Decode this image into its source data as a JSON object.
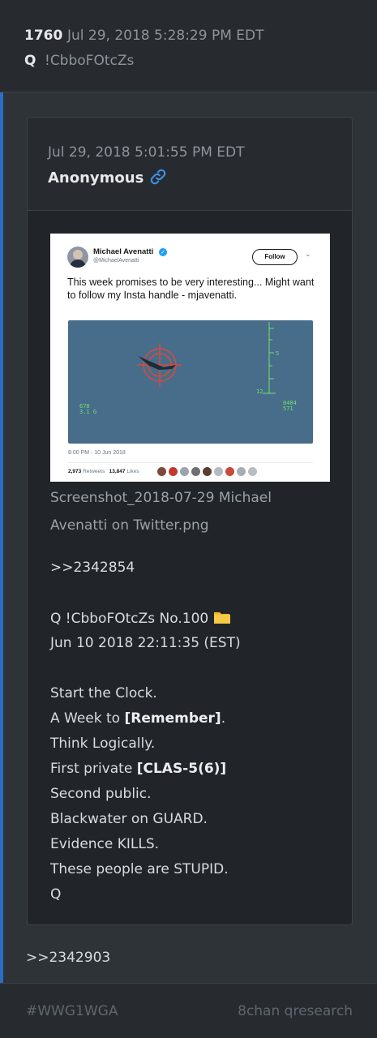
{
  "header": {
    "post_number": "1760",
    "date": "Jul 29, 2018 5:28:29 PM EDT",
    "author": "Q",
    "tripcode": "!CbboFOtcZs"
  },
  "quote": {
    "date": "Jul 29, 2018 5:01:55 PM EDT",
    "author": "Anonymous",
    "link_icon": "link-icon",
    "attachment": {
      "filename_line1": "Screenshot_2018-07-29 Michael",
      "filename_line2": "Avenatti on Twitter.png",
      "tweet": {
        "name": "Michael Avenatti",
        "handle": "@MichaelAvenatti",
        "verified_icon": "✓",
        "follow_label": "Follow",
        "chevron": "⌄",
        "text": "This week promises to be very interesting... Might want to follow my Insta handle - mjavenatti.",
        "hud_left_1": "678",
        "hud_left_2": "3.1 G",
        "hud_right_1": "0404",
        "hud_right_2": "571",
        "hud_num_1": "12",
        "hud_num_2": "5",
        "time": "8:00 PM - 10 Jun 2018",
        "retweets": "2,973",
        "retweets_label": "Retweets",
        "likes": "13,847",
        "likes_label": "Likes"
      }
    },
    "lines": [
      ">>2342854",
      "Q !CbboFOtcZs No.100",
      "Jun 10 2018 22:11:35 (EST)",
      "Start the Clock.",
      "A Week to ",
      "[Remember]",
      ".",
      "Think Logically.",
      "First private ",
      "[CLAS-5(6)]",
      "Second public.",
      "Blackwater on GUARD.",
      "Evidence KILLS.",
      "These people are STUPID.",
      "Q"
    ],
    "folder_icon": "folder-icon"
  },
  "reply_ref": ">>2342903",
  "footer": {
    "tag": "#WWG1WGA",
    "source": "8chan qresearch"
  },
  "colors": {
    "accent": "#2b6cc4",
    "link": "#3e8fe0",
    "background": "#2e3338",
    "card": "#212529"
  }
}
